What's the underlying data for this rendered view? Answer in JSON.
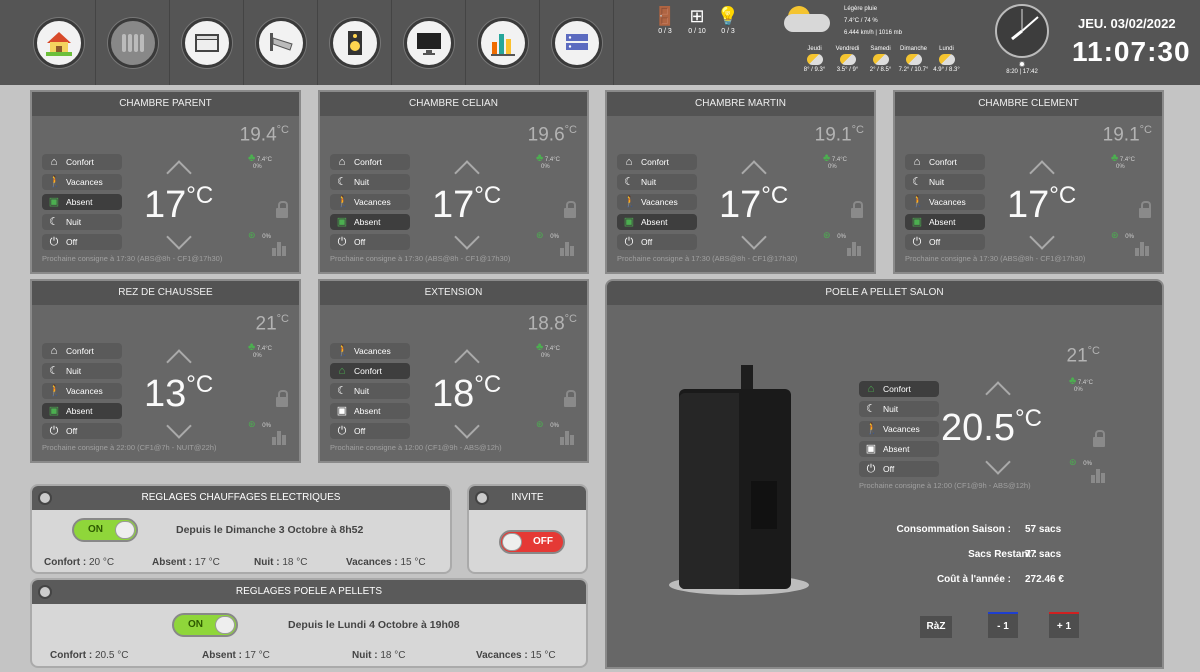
{
  "colors": {
    "accent_green": "#4caf50",
    "toggle_on": "#8fd63a",
    "toggle_off": "#e53935",
    "panel_bg": "#676767",
    "header_bg": "#535353",
    "topbar_bg": "#555555"
  },
  "nav": {
    "items": [
      {
        "icon": "house-icon"
      },
      {
        "icon": "radiator-icon"
      },
      {
        "icon": "shutter-icon"
      },
      {
        "icon": "camera-icon"
      },
      {
        "icon": "speaker-icon"
      },
      {
        "icon": "monitor-icon"
      },
      {
        "icon": "chart-icon"
      },
      {
        "icon": "server-icon"
      }
    ]
  },
  "status": {
    "doors": "0 / 3",
    "windows": "0 / 10",
    "lights": "0 / 3"
  },
  "weather": {
    "condition": "Légère pluie",
    "temp_hum": "7.4°C / 74 %",
    "wind_pressure": "6.444 km/h | 1016 mb",
    "sun": "8:20 | 17:42",
    "forecast": [
      {
        "day": "Jeudi",
        "t": "8° / 9.3°"
      },
      {
        "day": "Vendredi",
        "t": "3.5° / 9°"
      },
      {
        "day": "Samedi",
        "t": "2° / 8.5°"
      },
      {
        "day": "Dimanche",
        "t": "7.2° / 10.7°"
      },
      {
        "day": "Lundi",
        "t": "4.9° / 8.3°"
      }
    ]
  },
  "date": "JEU. 03/02/2022",
  "time": "11:07:30",
  "rooms": [
    {
      "title": "CHAMBRE PARENT",
      "current": "19.4",
      "target": "17",
      "out_t": "7.4",
      "out_h": "0",
      "pct": "0",
      "next": "Prochaine consigne à 17:30 (ABS@8h - CF1@17h30)",
      "modes": [
        {
          "label": "Confort",
          "icon": "house-icon"
        },
        {
          "label": "Vacances",
          "icon": "walker-icon"
        },
        {
          "label": "Absent",
          "icon": "briefcase-icon",
          "sel": true
        },
        {
          "label": "Nuit",
          "icon": "moon-icon"
        },
        {
          "label": "Off",
          "icon": "power-icon"
        }
      ]
    },
    {
      "title": "CHAMBRE CELIAN",
      "current": "19.6",
      "target": "17",
      "out_t": "7.4",
      "out_h": "0",
      "pct": "0",
      "next": "Prochaine consigne à 17:30 (ABS@8h - CF1@17h30)",
      "modes": [
        {
          "label": "Confort",
          "icon": "house-icon"
        },
        {
          "label": "Nuit",
          "icon": "moon-icon"
        },
        {
          "label": "Vacances",
          "icon": "walker-icon"
        },
        {
          "label": "Absent",
          "icon": "briefcase-icon",
          "sel": true
        },
        {
          "label": "Off",
          "icon": "power-icon"
        }
      ]
    },
    {
      "title": "CHAMBRE MARTIN",
      "current": "19.1",
      "target": "17",
      "out_t": "7.4",
      "out_h": "0",
      "pct": "0",
      "next": "Prochaine consigne à 17:30 (ABS@8h - CF1@17h30)",
      "modes": [
        {
          "label": "Confort",
          "icon": "house-icon"
        },
        {
          "label": "Nuit",
          "icon": "moon-icon"
        },
        {
          "label": "Vacances",
          "icon": "walker-icon"
        },
        {
          "label": "Absent",
          "icon": "briefcase-icon",
          "sel": true
        },
        {
          "label": "Off",
          "icon": "power-icon"
        }
      ]
    },
    {
      "title": "CHAMBRE CLEMENT",
      "current": "19.1",
      "target": "17",
      "out_t": "7.4",
      "out_h": "0",
      "pct": "0",
      "next": "Prochaine consigne à 17:30 (ABS@8h - CF1@17h30)",
      "modes": [
        {
          "label": "Confort",
          "icon": "house-icon"
        },
        {
          "label": "Nuit",
          "icon": "moon-icon"
        },
        {
          "label": "Vacances",
          "icon": "walker-icon"
        },
        {
          "label": "Absent",
          "icon": "briefcase-icon",
          "sel": true
        },
        {
          "label": "Off",
          "icon": "power-icon"
        }
      ]
    },
    {
      "title": "REZ DE CHAUSSEE",
      "current": "21",
      "target": "13",
      "out_t": "7.4",
      "out_h": "0",
      "pct": "0",
      "next": "Prochaine consigne à 22:00 (CF1@7h - NUIT@22h)",
      "modes": [
        {
          "label": "Confort",
          "icon": "house-icon"
        },
        {
          "label": "Nuit",
          "icon": "moon-icon"
        },
        {
          "label": "Vacances",
          "icon": "walker-icon"
        },
        {
          "label": "Absent",
          "icon": "briefcase-icon",
          "sel": true
        },
        {
          "label": "Off",
          "icon": "power-icon"
        }
      ]
    },
    {
      "title": "EXTENSION",
      "current": "18.8",
      "target": "18",
      "out_t": "7.4",
      "out_h": "0",
      "pct": "0",
      "next": "Prochaine consigne à 12:00 (CF1@9h - ABS@12h)",
      "modes": [
        {
          "label": "Vacances",
          "icon": "walker-icon"
        },
        {
          "label": "Confort",
          "icon": "house-icon",
          "sel": true
        },
        {
          "label": "Nuit",
          "icon": "moon-icon"
        },
        {
          "label": "Absent",
          "icon": "briefcase-icon"
        },
        {
          "label": "Off",
          "icon": "power-icon"
        }
      ]
    }
  ],
  "poele": {
    "title": "POELE A PELLET SALON",
    "current": "21",
    "target": "20.5",
    "out_t": "7.4",
    "out_h": "0",
    "pct": "0",
    "next": "Prochaine consigne à 12:00 (CF1@9h - ABS@12h)",
    "modes": [
      {
        "label": "Confort",
        "icon": "house-icon",
        "sel": true
      },
      {
        "label": "Nuit",
        "icon": "moon-icon"
      },
      {
        "label": "Vacances",
        "icon": "walker-icon"
      },
      {
        "label": "Absent",
        "icon": "briefcase-icon"
      },
      {
        "label": "Off",
        "icon": "power-icon"
      }
    ],
    "conso_label": "Consommation Saison :",
    "conso": "57 sacs",
    "restant_label": "Sacs Restant :",
    "restant": "77 sacs",
    "cout_label": "Coût à l'année :",
    "cout": "272.46 €",
    "raz": "RàZ",
    "minus": "- 1",
    "plus": "+ 1"
  },
  "reg_elec": {
    "title": "REGLAGES CHAUFFAGES ELECTRIQUES",
    "toggle": "ON",
    "since": "Depuis le Dimanche 3 Octobre à 8h52",
    "confort_l": "Confort :",
    "confort": "20 °C",
    "absent_l": "Absent :",
    "absent": "17 °C",
    "nuit_l": "Nuit :",
    "nuit": "18 °C",
    "vac_l": "Vacances :",
    "vac": "15 °C"
  },
  "invite": {
    "title": "INVITE",
    "toggle": "OFF"
  },
  "reg_poele": {
    "title": "REGLAGES POELE A PELLETS",
    "toggle": "ON",
    "since": "Depuis le Lundi 4 Octobre à 19h08",
    "confort_l": "Confort :",
    "confort": "20.5 °C",
    "absent_l": "Absent :",
    "absent": "17 °C",
    "nuit_l": "Nuit :",
    "nuit": "18 °C",
    "vac_l": "Vacances :",
    "vac": "15 °C"
  }
}
